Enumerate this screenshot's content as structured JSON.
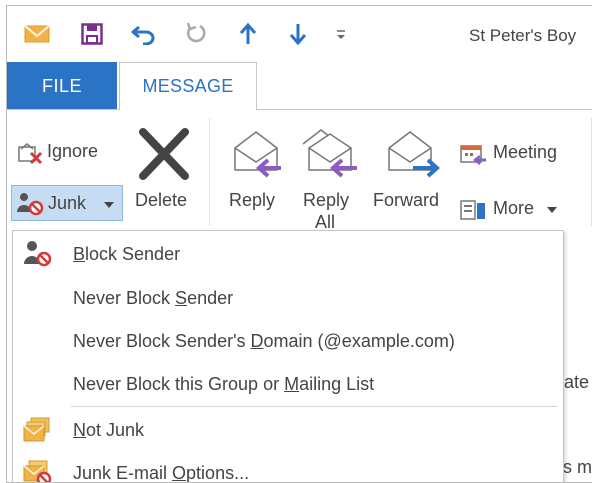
{
  "window": {
    "title": "St Peter's Boy"
  },
  "tabs": {
    "file": "FILE",
    "message": "MESSAGE"
  },
  "ribbon": {
    "ignore": "Ignore",
    "junk": "Junk",
    "delete": "Delete",
    "reply": "Reply",
    "reply_all_line1": "Reply",
    "reply_all_line2": "All",
    "forward": "Forward",
    "meeting": "Meeting",
    "more": "More"
  },
  "junk_menu": {
    "items": [
      {
        "pre": "",
        "accel": "B",
        "post": "lock Sender"
      },
      {
        "pre": "Never Block ",
        "accel": "S",
        "post": "ender"
      },
      {
        "pre": "Never Block Sender's ",
        "accel": "D",
        "post": "omain (@example.com)"
      },
      {
        "pre": "Never Block this Group or ",
        "accel": "M",
        "post": "ailing List"
      },
      {
        "pre": "",
        "accel": "N",
        "post": "ot Junk"
      },
      {
        "pre": "Junk E-mail ",
        "accel": "O",
        "post": "ptions..."
      }
    ]
  },
  "background": {
    "text_1": "tate",
    "text_2": "is m"
  },
  "colors": {
    "accent": "#2b73c5",
    "junk_highlight": "#c5dcf3",
    "arrow_purple": "#8a5cc4",
    "arrow_blue": "#2b73c5"
  }
}
